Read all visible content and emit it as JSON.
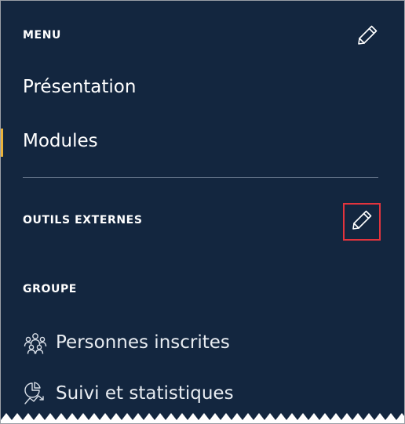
{
  "menu": {
    "title": "MENU",
    "edit_icon": "pencil-icon",
    "items": [
      {
        "label": "Présentation",
        "active": false
      },
      {
        "label": "Modules",
        "active": true
      }
    ]
  },
  "external_tools": {
    "title": "OUTILS EXTERNES",
    "edit_icon": "pencil-icon"
  },
  "group": {
    "title": "GROUPE",
    "items": [
      {
        "label": "Personnes inscrites",
        "icon": "people-group-icon"
      },
      {
        "label": "Suivi et statistiques",
        "icon": "stats-icon"
      }
    ]
  },
  "colors": {
    "background": "#13263f",
    "text": "#ffffff",
    "active_indicator": "#e9b23b",
    "highlight_border": "#e2343d",
    "divider": "#5c6c82"
  }
}
